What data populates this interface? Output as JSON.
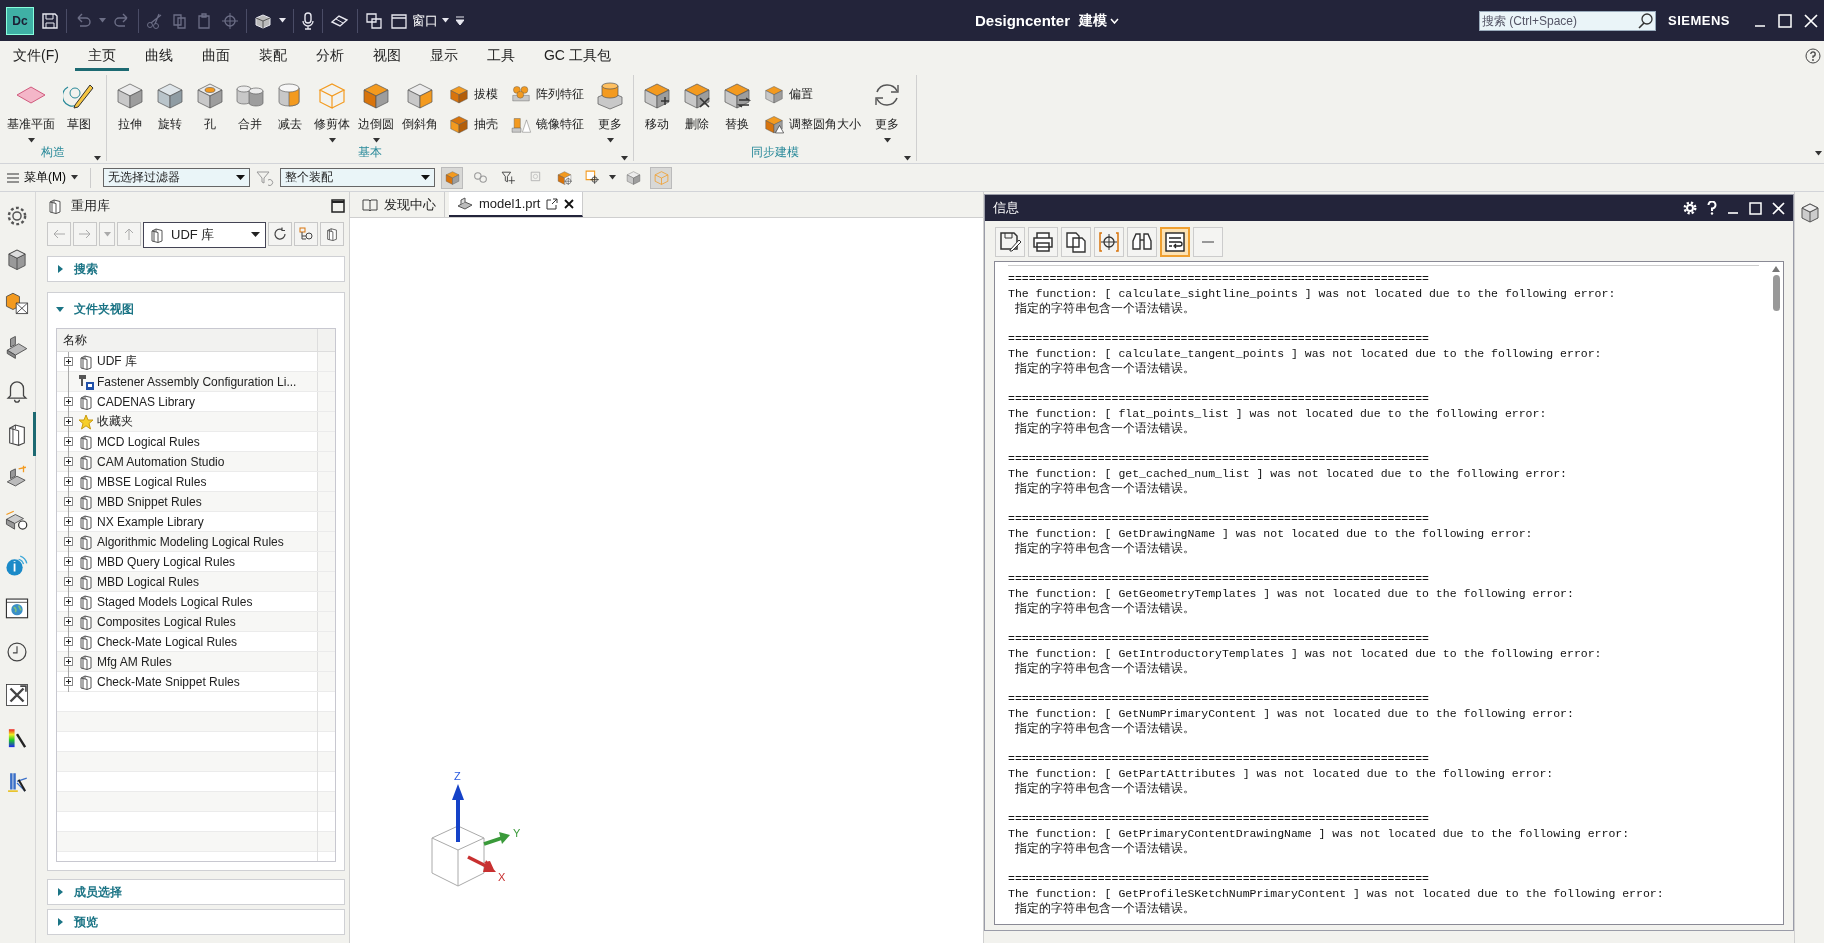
{
  "titlebar": {
    "logo": "Dc",
    "window_menu": "窗口",
    "app_name": "Designcenter",
    "mode": "建模",
    "search": {
      "placeholder": "搜索 (Ctrl+Space)"
    },
    "brand": "SIEMENS"
  },
  "ribbon": {
    "tabs": [
      {
        "label": "文件(F)",
        "selected": false
      },
      {
        "label": "主页",
        "selected": true
      },
      {
        "label": "曲线",
        "selected": false
      },
      {
        "label": "曲面",
        "selected": false
      },
      {
        "label": "装配",
        "selected": false
      },
      {
        "label": "分析",
        "selected": false
      },
      {
        "label": "视图",
        "selected": false
      },
      {
        "label": "显示",
        "selected": false
      },
      {
        "label": "工具",
        "selected": false
      },
      {
        "label": "GC 工具包",
        "selected": false
      }
    ],
    "groups": [
      {
        "label": "构造",
        "buttons": [
          {
            "label": "基准平面",
            "kind": "plane",
            "dropdown": true
          },
          {
            "label": "草图",
            "kind": "sketch",
            "dropdown": false
          }
        ]
      },
      {
        "label": "基本",
        "buttons": [
          {
            "label": "拉伸",
            "kind": "extrude",
            "dropdown": false
          },
          {
            "label": "旋转",
            "kind": "revolve",
            "dropdown": false
          },
          {
            "label": "孔",
            "kind": "hole",
            "dropdown": false
          },
          {
            "label": "合并",
            "kind": "unite",
            "dropdown": false
          },
          {
            "label": "减去",
            "kind": "subtract",
            "dropdown": false
          },
          {
            "label": "修剪体",
            "kind": "trim",
            "dropdown": true
          },
          {
            "label": "边倒圆",
            "kind": "blend",
            "dropdown": true
          },
          {
            "label": "倒斜角",
            "kind": "chamfer",
            "dropdown": false
          },
          {
            "label": "拔模",
            "kind": "draft",
            "dropdown": false
          },
          {
            "label": "抽壳",
            "kind": "shell",
            "dropdown": false
          },
          {
            "label": "阵列特征",
            "kind": "pattern",
            "dropdown": false
          },
          {
            "label": "镜像特征",
            "kind": "mirror",
            "dropdown": false
          },
          {
            "label": "更多",
            "kind": "stack",
            "dropdown": true
          }
        ]
      },
      {
        "label": "同步建模",
        "buttons": [
          {
            "label": "移动",
            "kind": "move",
            "dropdown": false
          },
          {
            "label": "删除",
            "kind": "delete",
            "dropdown": false
          },
          {
            "label": "替换",
            "kind": "replace",
            "dropdown": false
          },
          {
            "label": "偏置",
            "kind": "offset",
            "dropdown": false
          },
          {
            "label": "调整圆角大小",
            "kind": "resize",
            "dropdown": false
          },
          {
            "label": "更多",
            "kind": "refresh",
            "dropdown": true
          }
        ]
      }
    ]
  },
  "filter_bar": {
    "menu": "菜单(M)",
    "selection_filter": "无选择过滤器",
    "scope": "整个装配",
    "tools": [
      {
        "pressed": true
      },
      {
        "pressed": false
      },
      {
        "pressed": false
      },
      {
        "pressed": false
      },
      {
        "pressed": false
      },
      {
        "pressed": false
      },
      {
        "pressed": false
      },
      {
        "pressed": true
      }
    ]
  },
  "side_tools": [
    {
      "kind": "gear",
      "selected": false
    },
    {
      "kind": "cube",
      "selected": false
    },
    {
      "kind": "navigator",
      "selected": false
    },
    {
      "kind": "bracket",
      "selected": false
    },
    {
      "kind": "bell",
      "selected": false
    },
    {
      "kind": "library",
      "selected": true
    },
    {
      "kind": "measure",
      "selected": false
    },
    {
      "kind": "inspect",
      "selected": false
    },
    {
      "kind": "info",
      "selected": false
    },
    {
      "kind": "web",
      "selected": false
    },
    {
      "kind": "clock",
      "selected": false
    },
    {
      "kind": "tools",
      "selected": false
    },
    {
      "kind": "spectrum",
      "selected": false
    },
    {
      "kind": "drill",
      "selected": false
    }
  ],
  "reuse_library": {
    "title": "重用库",
    "location": "UDF 库",
    "sections": [
      {
        "label": "搜索",
        "expanded": false
      },
      {
        "label": "文件夹视图",
        "expanded": true
      },
      {
        "label": "成员选择",
        "expanded": false
      },
      {
        "label": "预览",
        "expanded": false
      }
    ],
    "column": "名称",
    "items": [
      {
        "label": "UDF 库",
        "kind": "library",
        "expandable": true
      },
      {
        "label": "Fastener Assembly Configuration Li...",
        "kind": "fastener",
        "expandable": false
      },
      {
        "label": "CADENAS Library",
        "kind": "library",
        "expandable": true
      },
      {
        "label": "收藏夹",
        "kind": "favorites",
        "expandable": true
      },
      {
        "label": "MCD Logical Rules",
        "kind": "library",
        "expandable": true
      },
      {
        "label": "CAM Automation Studio",
        "kind": "library",
        "expandable": true
      },
      {
        "label": "MBSE Logical Rules",
        "kind": "library",
        "expandable": true
      },
      {
        "label": "MBD Snippet Rules",
        "kind": "library",
        "expandable": true
      },
      {
        "label": "NX Example Library",
        "kind": "library",
        "expandable": true
      },
      {
        "label": "Algorithmic Modeling Logical Rules",
        "kind": "library",
        "expandable": true
      },
      {
        "label": "MBD Query Logical Rules",
        "kind": "library",
        "expandable": true
      },
      {
        "label": "MBD Logical Rules",
        "kind": "library",
        "expandable": true
      },
      {
        "label": "Staged Models Logical Rules",
        "kind": "library",
        "expandable": true
      },
      {
        "label": "Composites Logical Rules",
        "kind": "library",
        "expandable": true
      },
      {
        "label": "Check-Mate Logical Rules",
        "kind": "library",
        "expandable": true
      },
      {
        "label": "Mfg AM Rules",
        "kind": "library",
        "expandable": true
      },
      {
        "label": "Check-Mate Snippet Rules",
        "kind": "library",
        "expandable": true
      }
    ]
  },
  "graphics": {
    "tabs": [
      {
        "label": "发现中心",
        "kind": "discovery",
        "selected": false
      },
      {
        "label": "model1.prt",
        "kind": "part",
        "selected": true
      }
    ],
    "axes": {
      "x": "X",
      "y": "Y",
      "z": "Z"
    }
  },
  "info_window": {
    "title": "信息",
    "tools": [
      {
        "kind": "save",
        "selected": false
      },
      {
        "kind": "print",
        "selected": false
      },
      {
        "kind": "copy",
        "selected": false
      },
      {
        "kind": "target",
        "selected": false
      },
      {
        "kind": "find",
        "selected": false
      },
      {
        "kind": "wrap",
        "selected": true
      },
      {
        "kind": "minus",
        "selected": false
      }
    ],
    "entries": [
      {
        "separator": "=============================================================",
        "message": "The function: [ calculate_sightline_points ] was not located due to the following error:",
        "error": "指定的字符串包含一个语法错误。"
      },
      {
        "separator": "=============================================================",
        "message": "The function: [ calculate_tangent_points ] was not located due to the following error:",
        "error": "指定的字符串包含一个语法错误。"
      },
      {
        "separator": "=============================================================",
        "message": "The function: [ flat_points_list ] was not located due to the following error:",
        "error": "指定的字符串包含一个语法错误。"
      },
      {
        "separator": "=============================================================",
        "message": "The function: [ get_cached_num_list ] was not located due to the following error:",
        "error": "指定的字符串包含一个语法错误。"
      },
      {
        "separator": "=============================================================",
        "message": "The function: [ GetDrawingName ] was not located due to the following error:",
        "error": "指定的字符串包含一个语法错误。"
      },
      {
        "separator": "=============================================================",
        "message": "The function: [ GetGeometryTemplates ] was not located due to the following error:",
        "error": "指定的字符串包含一个语法错误。"
      },
      {
        "separator": "=============================================================",
        "message": "The function: [ GetIntroductoryTemplates ] was not located due to the following error:",
        "error": "指定的字符串包含一个语法错误。"
      },
      {
        "separator": "=============================================================",
        "message": "The function: [ GetNumPrimaryContent ] was not located due to the following error:",
        "error": "指定的字符串包含一个语法错误。"
      },
      {
        "separator": "=============================================================",
        "message": "The function: [ GetPartAttributes ] was not located due to the following error:",
        "error": "指定的字符串包含一个语法错误。"
      },
      {
        "separator": "=============================================================",
        "message": "The function: [ GetPrimaryContentDrawingName ] was not located due to the following error:",
        "error": "指定的字符串包含一个语法错误。"
      },
      {
        "separator": "=============================================================",
        "message": "The function: [ GetProfileSKetchNumPrimaryContent ] was not located due to the following error:",
        "error": "指定的字符串包含一个语法错误。"
      }
    ]
  }
}
